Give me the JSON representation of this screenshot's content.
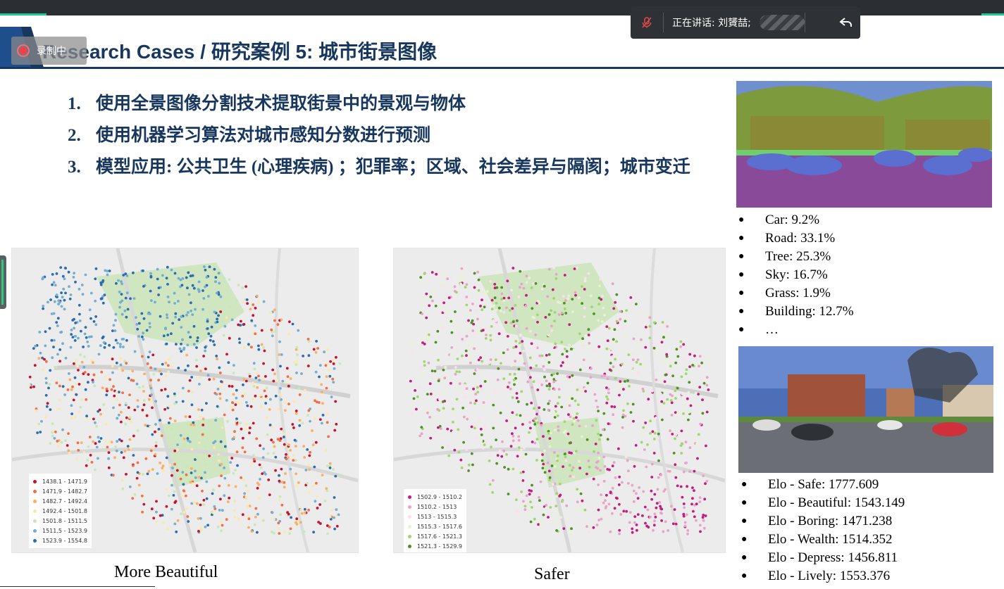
{
  "window": {
    "speaker_prefix": "正在讲话: ",
    "speaker_name": "刘贇喆;",
    "recording_label": "录制中"
  },
  "slide": {
    "title": "Research Cases / 研究案例 5: 城市街景图像",
    "points": [
      {
        "num": "1.",
        "text": "使用全景图像分割技术提取街景中的景观与物体"
      },
      {
        "num": "2.",
        "text": "使用机器学习算法对城市感知分数进行预测"
      },
      {
        "num": "3.",
        "text": "模型应用: 公共卫生 (心理疾病) ；犯罪率；区域、社会差异与隔阂；城市变迁"
      }
    ],
    "maps": [
      {
        "caption": "More Beautiful",
        "legend": [
          {
            "label": "1438.1 - 1471.9",
            "color": "#c8102e"
          },
          {
            "label": "1471.9 - 1482.7",
            "color": "#f46d43"
          },
          {
            "label": "1482.7 - 1492.4",
            "color": "#fdae61"
          },
          {
            "label": "1492.4 - 1501.8",
            "color": "#fee8a8"
          },
          {
            "label": "1501.8 - 1511.5",
            "color": "#c7e9b4"
          },
          {
            "label": "1511.5 - 1523.9",
            "color": "#74add1"
          },
          {
            "label": "1523.9 - 1554.8",
            "color": "#2b6cb0"
          }
        ]
      },
      {
        "caption": "Safer",
        "legend": [
          {
            "label": "1502.9 - 1510.2",
            "color": "#c51b7d"
          },
          {
            "label": "1510.2 - 1513",
            "color": "#e9a3c9"
          },
          {
            "label": "1513 - 1515.3",
            "color": "#fde0ef"
          },
          {
            "label": "1515.3 - 1517.6",
            "color": "#e6f5d0"
          },
          {
            "label": "1517.6 - 1521.3",
            "color": "#a1d76a"
          },
          {
            "label": "1521.3 - 1529.9",
            "color": "#4d9221"
          }
        ]
      }
    ],
    "segmentation": [
      {
        "label": "Car: 9.2%"
      },
      {
        "label": "Road: 33.1%"
      },
      {
        "label": "Tree: 25.3%"
      },
      {
        "label": "Sky: 16.7%"
      },
      {
        "label": "Grass: 1.9%"
      },
      {
        "label": "Building: 12.7%"
      },
      {
        "label": "…"
      }
    ],
    "elo": [
      {
        "label": "Elo - Safe: 1777.609"
      },
      {
        "label": "Elo - Beautiful: 1543.149"
      },
      {
        "label": "Elo - Boring: 1471.238"
      },
      {
        "label": "Elo - Wealth: 1514.352"
      },
      {
        "label": "Elo - Depress: 1456.811"
      },
      {
        "label": "Elo - Lively: 1553.376"
      }
    ]
  }
}
